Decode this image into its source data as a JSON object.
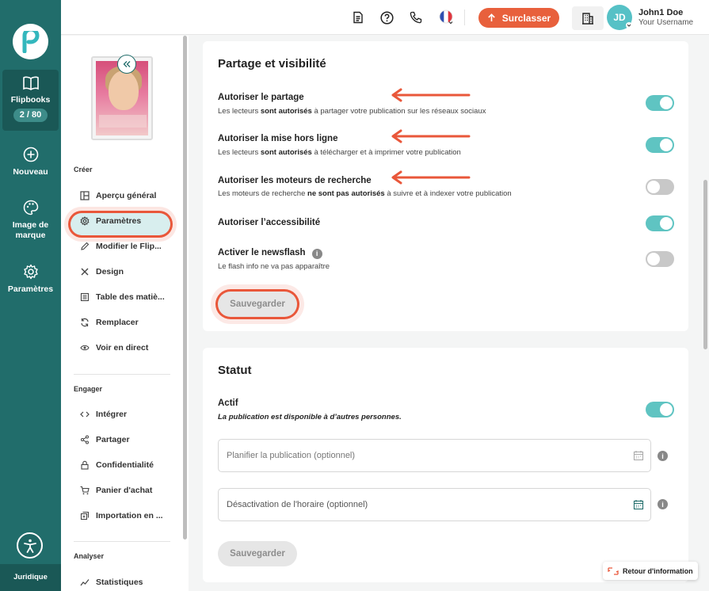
{
  "rail": {
    "items": [
      {
        "label": "Flipbooks",
        "count": "2 / 80"
      },
      {
        "label": "Nouveau"
      },
      {
        "label": "Image de marque"
      },
      {
        "label": "Paramètres"
      }
    ],
    "legal": "Juridique"
  },
  "topbar": {
    "upgrade_label": "Surclasser",
    "user_name": "John1 Doe",
    "user_subtitle": "Your Username",
    "avatar_initials": "JD"
  },
  "sidebar": {
    "cover_text": "Aperçu",
    "sections": [
      {
        "label": "Créer",
        "items": [
          "Aperçu général",
          "Paramètres",
          "Modifier le Flip...",
          "Design",
          "Table des matiè...",
          "Remplacer",
          "Voir en direct"
        ]
      },
      {
        "label": "Engager",
        "items": [
          "Intégrer",
          "Partager",
          "Confidentialité",
          "Panier d'achat",
          "Importation en ..."
        ]
      },
      {
        "label": "Analyser",
        "items": [
          "Statistiques"
        ]
      }
    ]
  },
  "sharing": {
    "title": "Partage et visibilité",
    "rows": [
      {
        "title": "Autoriser le partage",
        "desc_pre": "Les lecteurs ",
        "desc_bold": "sont autorisés",
        "desc_post": " à partager votre publication sur les réseaux sociaux",
        "on": true
      },
      {
        "title": "Autoriser la mise hors ligne",
        "desc_pre": "Les lecteurs ",
        "desc_bold": "sont autorisés",
        "desc_post": " à télécharger et à imprimer votre publication",
        "on": true
      },
      {
        "title": "Autoriser les moteurs de recherche",
        "desc_pre": "Les moteurs de recherche ",
        "desc_bold": "ne sont pas autorisés",
        "desc_post": " à suivre et à indexer votre publication",
        "on": false
      },
      {
        "title": "Autoriser l’accessibilité",
        "on": true
      },
      {
        "title": "Activer le newsflash",
        "desc_pre": "Le flash info ne va pas apparaître",
        "on": false
      }
    ],
    "save_label": "Sauvegarder"
  },
  "status": {
    "title": "Statut",
    "active_label": "Actif",
    "active_desc": "La publication est disponible à d’autres personnes.",
    "schedule_placeholder": "Planifier la publication (optionnel)",
    "deactivate_placeholder": "Désactivation de l'horaire (optionnel)",
    "save_label": "Sauvegarder"
  },
  "feedback_label": "Retour d'information",
  "colors": {
    "rail": "#216d6b",
    "accent": "#e8603c",
    "toggle_on": "#5fc4c2",
    "active_bg": "#d8eeee"
  }
}
